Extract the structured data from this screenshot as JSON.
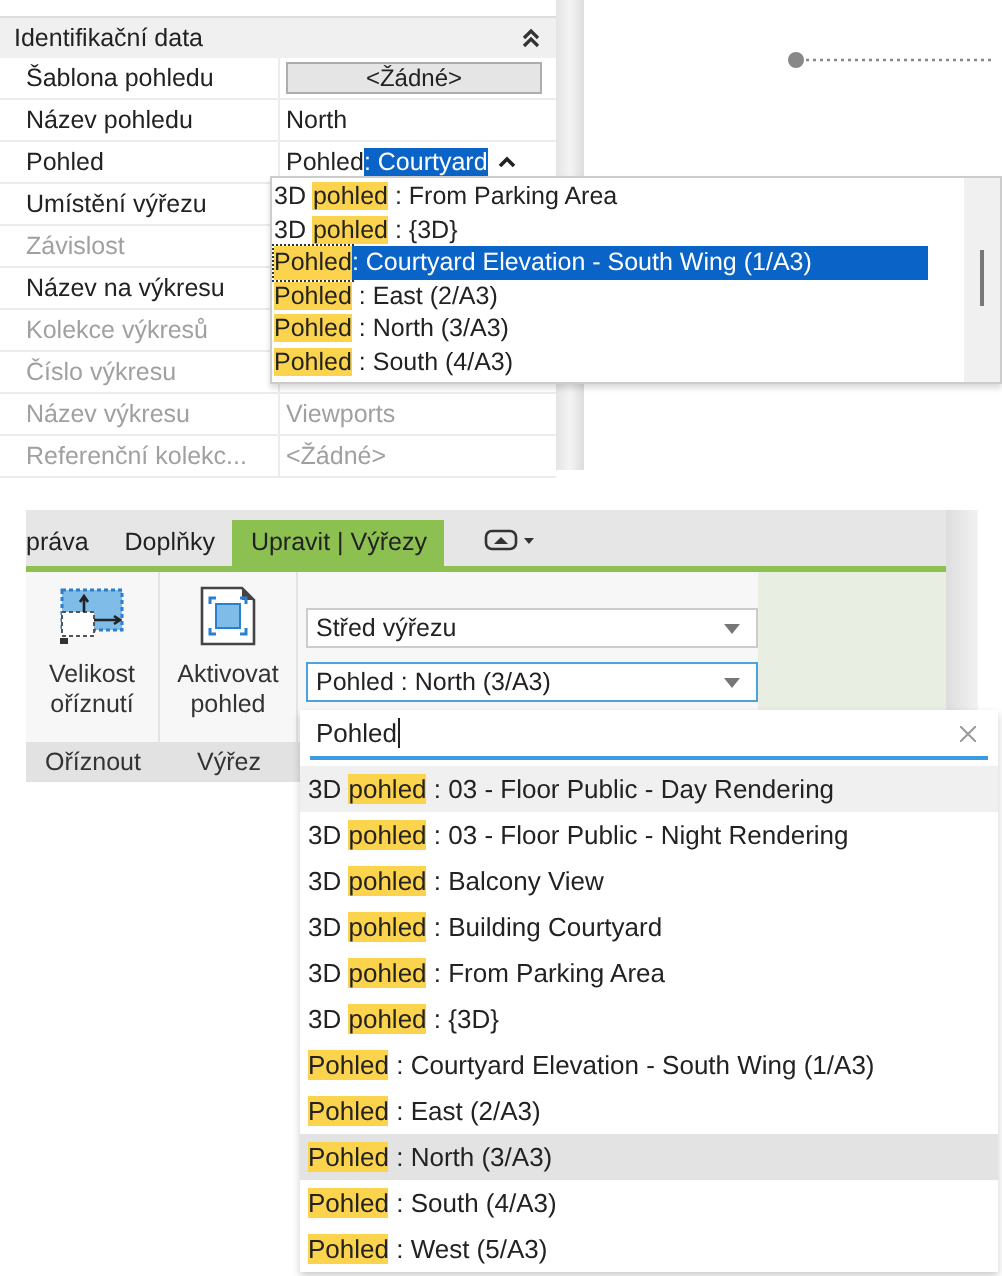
{
  "properties": {
    "group": {
      "title": "Identifikační data",
      "expanded": true
    },
    "rows": [
      {
        "label": "Šablona pohledu",
        "kind": "button",
        "value": "<Žádné>",
        "disabled": false
      },
      {
        "label": "Název pohledu",
        "kind": "text",
        "value": "North",
        "disabled": false
      },
      {
        "label": "Pohled",
        "kind": "combo",
        "value": "Pohled",
        "selection": ": Courtyard",
        "disabled": false
      },
      {
        "label": "Umístění výřezu",
        "kind": "text",
        "disabled": false
      },
      {
        "label": "Závislost",
        "kind": "text",
        "disabled": true
      },
      {
        "label": "Název na výkresu",
        "kind": "text",
        "disabled": false
      },
      {
        "label": "Kolekce výkresů",
        "kind": "text",
        "disabled": true
      },
      {
        "label": "Číslo výkresu",
        "kind": "text",
        "disabled": true
      },
      {
        "label": "Název výkresu",
        "kind": "text",
        "value": "Viewports",
        "disabled": true
      },
      {
        "label": "Referenční kolekc...",
        "kind": "text",
        "value": "<Žádné>",
        "disabled": true
      }
    ]
  },
  "property_dropdown": {
    "items": [
      {
        "before": "3D ",
        "match": "pohled",
        "after": " : From Parking Area",
        "selected": false
      },
      {
        "before": "3D ",
        "match": "pohled",
        "after": " : {3D}",
        "selected": false
      },
      {
        "match": "Pohled",
        "after": " : Courtyard Elevation - South Wing (1/A3)",
        "selected": true
      },
      {
        "match": "Pohled",
        "after": " : East (2/A3)",
        "selected": false
      },
      {
        "match": "Pohled",
        "after": " : North (3/A3)",
        "selected": false
      },
      {
        "match": "Pohled",
        "after": " : South (4/A3)",
        "selected": false
      }
    ]
  },
  "ribbon": {
    "tabs": [
      {
        "label": "práva",
        "selected": false
      },
      {
        "label": "Doplňky",
        "selected": false
      },
      {
        "label": "Upravit | Výřezy",
        "selected": true
      }
    ],
    "buttons": [
      {
        "kind": "crop",
        "label": "Velikost oříznutí",
        "panel": "Oříznout"
      },
      {
        "kind": "activate",
        "label": "Aktivovat pohled",
        "panel": "Výřez"
      }
    ],
    "combos": [
      {
        "value": "Střed výřezu",
        "focused": false
      },
      {
        "value": "Pohled : North (3/A3)",
        "focused": true
      }
    ]
  },
  "view_dropdown": {
    "search": "Pohled",
    "items": [
      {
        "before": "3D ",
        "match": "pohled",
        "after": " : 03 - Floor Public - Day Rendering",
        "selected": false,
        "hovered": true
      },
      {
        "before": "3D ",
        "match": "pohled",
        "after": " : 03 - Floor Public - Night Rendering",
        "selected": false,
        "hovered": false
      },
      {
        "before": "3D ",
        "match": "pohled",
        "after": " : Balcony View",
        "selected": false,
        "hovered": false
      },
      {
        "before": "3D ",
        "match": "pohled",
        "after": " : Building Courtyard",
        "selected": false,
        "hovered": false
      },
      {
        "before": "3D ",
        "match": "pohled",
        "after": " : From Parking Area",
        "selected": false,
        "hovered": false
      },
      {
        "before": "3D ",
        "match": "pohled",
        "after": " : {3D}",
        "selected": false,
        "hovered": false
      },
      {
        "match": "Pohled",
        "after": " : Courtyard Elevation - South Wing (1/A3)",
        "selected": false,
        "hovered": false
      },
      {
        "match": "Pohled",
        "after": " : East (2/A3)",
        "selected": false,
        "hovered": false
      },
      {
        "match": "Pohled",
        "after": " : North (3/A3)",
        "selected": true,
        "hovered": false
      },
      {
        "match": "Pohled",
        "after": " : South (4/A3)",
        "selected": false,
        "hovered": false
      },
      {
        "match": "Pohled",
        "after": " : West (5/A3)",
        "selected": false,
        "hovered": false
      }
    ]
  }
}
